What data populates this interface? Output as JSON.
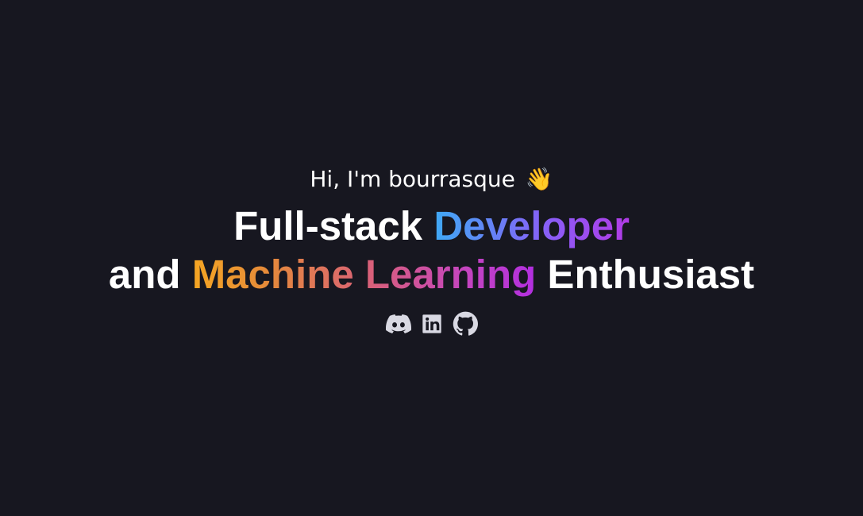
{
  "hero": {
    "greeting_text": "Hi, I'm bourrasque",
    "greeting_emoji": "👋",
    "headline": {
      "line1_plain": "Full-stack ",
      "line1_highlight": "Developer",
      "line2_plain_start": "and ",
      "line2_highlight": "Machine Learning",
      "line2_plain_end": " Enthusiast"
    },
    "social_links": [
      {
        "name": "discord",
        "icon": "discord-icon"
      },
      {
        "name": "linkedin",
        "icon": "linkedin-icon"
      },
      {
        "name": "github",
        "icon": "github-icon"
      }
    ]
  },
  "colors": {
    "background": "#171720",
    "text": "#ffffff",
    "developer_gradient": [
      "#3fa9f5",
      "#8b5cf6",
      "#b13be6"
    ],
    "ml_gradient": [
      "#f5a623",
      "#d9607a",
      "#b22fe0"
    ],
    "icon": "#d9d9e3"
  }
}
